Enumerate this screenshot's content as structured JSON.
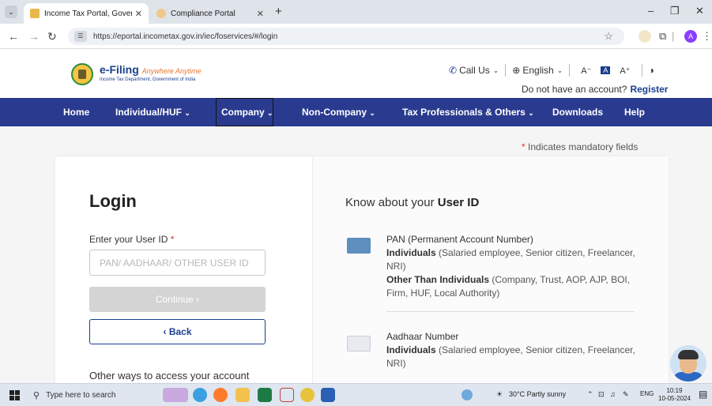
{
  "browser": {
    "tabs": [
      {
        "title": "Income Tax Portal, Government",
        "active": true
      },
      {
        "title": "Compliance Portal",
        "active": false
      }
    ],
    "url": "https://eportal.incometax.gov.in/iec/foservices/#/login",
    "profile_initial": "A"
  },
  "header": {
    "logo_title": "e-Filing",
    "logo_tagline": "Anywhere Anytime",
    "logo_subtitle": "Income Tax Department, Government of India",
    "call_us": "Call Us",
    "language": "English",
    "font_decrease": "A⁻",
    "font_default": "A",
    "font_increase": "A⁺",
    "no_account_text": "Do not have an account?",
    "register_label": "Register"
  },
  "nav": {
    "items": [
      "Home",
      "Individual/HUF",
      "Company",
      "Non-Company",
      "Tax Professionals & Others",
      "Downloads",
      "Help"
    ]
  },
  "mandatory_note": "Indicates mandatory fields",
  "login": {
    "title": "Login",
    "user_id_label": "Enter your User ID",
    "user_id_placeholder": "PAN/ AADHAAR/ OTHER USER ID",
    "continue_label": "Continue ›",
    "back_label": "‹ Back",
    "other_ways": "Other ways to access your account"
  },
  "know": {
    "title_prefix": "Know about your",
    "title_bold": "User ID",
    "pan": {
      "heading": "PAN (Permanent Account Number)",
      "ind_label": "Individuals",
      "ind_text": "(Salaried employee, Senior citizen, Freelancer, NRI)",
      "oth_label": "Other Than Individuals",
      "oth_text": "(Company, Trust, AOP, AJP, BOI, Firm, HUF, Local Authority)"
    },
    "aadhaar": {
      "heading": "Aadhaar Number",
      "ind_label": "Individuals",
      "ind_text": "(Salaried employee, Senior citizen, Freelancer, NRI)"
    }
  },
  "taskbar": {
    "search_placeholder": "Type here to search",
    "weather": "30°C  Partly sunny",
    "lang": "ENG",
    "time": "10:19",
    "date": "10-05-2024"
  }
}
